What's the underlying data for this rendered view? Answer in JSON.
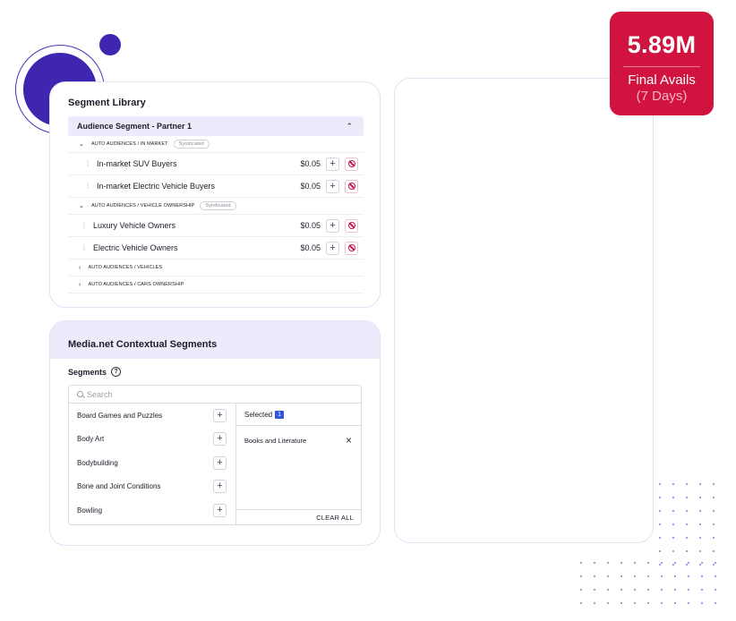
{
  "avails": {
    "value": "5.89M",
    "label": "Final Avails",
    "sub": "(7 Days)",
    "color": "#d1143f"
  },
  "segment_library": {
    "title": "Segment Library",
    "accordion_title": "Audience Segment - Partner 1",
    "groups": [
      {
        "label": "AUTO AUDIENCES / IN MARKET",
        "badge": "Syndicated",
        "expanded": true,
        "items": [
          {
            "name": "In-market SUV Buyers",
            "price": "$0.05"
          },
          {
            "name": "In-market Electric Vehicle Buyers",
            "price": "$0.05"
          }
        ]
      },
      {
        "label": "AUTO AUDIENCES / VEHICLE OWNERSHIP",
        "badge": "Syndicated",
        "expanded": true,
        "items": [
          {
            "name": "Luxury Vehicle Owners",
            "price": "$0.05"
          },
          {
            "name": "Electric Vehicle Owners",
            "price": "$0.05"
          }
        ]
      },
      {
        "label": "AUTO AUDIENCES / VEHICLES",
        "expanded": false
      },
      {
        "label": "AUTO AUDIENCES / CARS OWNERSHIP",
        "expanded": false
      }
    ]
  },
  "contextual": {
    "title": "Media.net Contextual Segments",
    "segments_label": "Segments",
    "help_glyph": "?",
    "search_placeholder": "Search",
    "options": [
      "Board Games and Puzzles",
      "Body Art",
      "Bodybuilding",
      "Bone and Joint Conditions",
      "Bowling"
    ],
    "selected_label": "Selected",
    "selected_count": "1",
    "selected_items": [
      "Books and Literature"
    ],
    "clear_all": "CLEAR ALL"
  },
  "colors": {
    "accent_purple": "#3f25b0",
    "header_lilac": "#eeeafb",
    "block_red": "#c9154a",
    "count_blue": "#2f55e4"
  }
}
